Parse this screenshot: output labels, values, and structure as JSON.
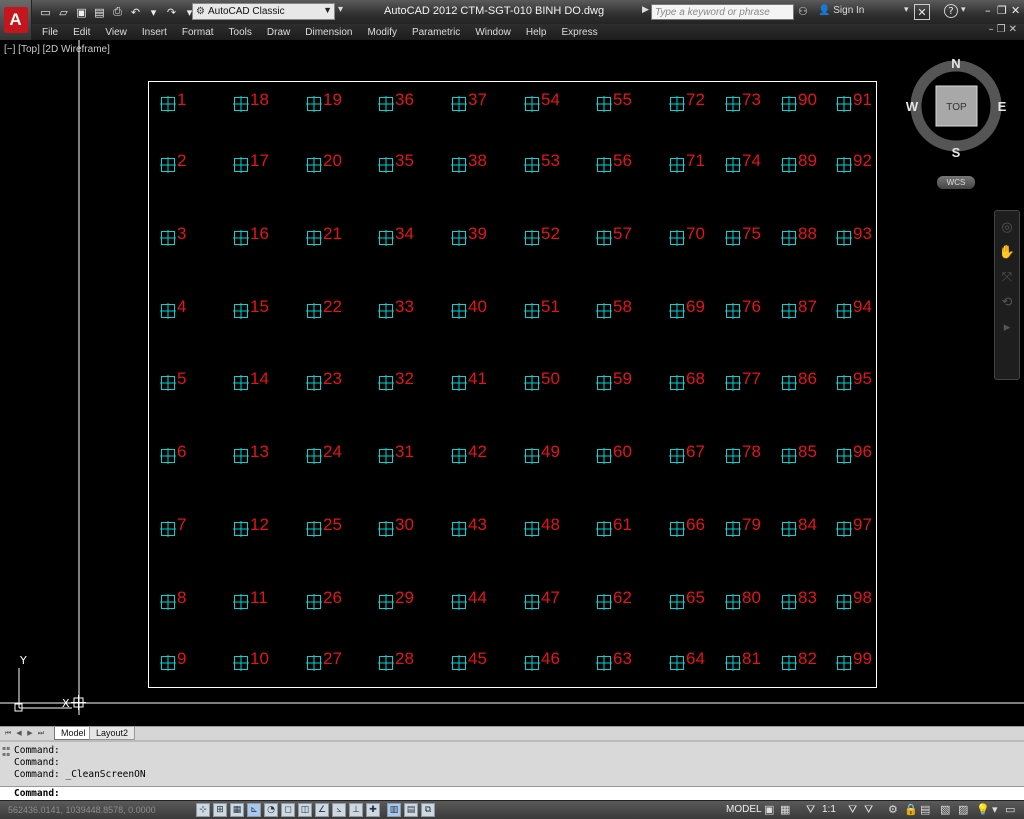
{
  "titlebar": {
    "app_logo": "A",
    "quick_access": [
      {
        "name": "new-icon",
        "glyph": "▭"
      },
      {
        "name": "open-icon",
        "glyph": "▱"
      },
      {
        "name": "save-icon",
        "glyph": "▣"
      },
      {
        "name": "saveas-icon",
        "glyph": "▤"
      },
      {
        "name": "print-icon",
        "glyph": "⎙"
      },
      {
        "name": "undo-icon",
        "glyph": "↶"
      },
      {
        "name": "undo-dropdown-icon",
        "glyph": "▾"
      },
      {
        "name": "redo-icon",
        "glyph": "↷"
      },
      {
        "name": "redo-dropdown-icon",
        "glyph": "▾"
      }
    ],
    "workspace": "AutoCAD Classic",
    "title": "AutoCAD 2012    CTM-SGT-010 BINH DO.dwg",
    "search_placeholder": "Type a keyword or phrase",
    "signin": "Sign In"
  },
  "menus": [
    "File",
    "Edit",
    "View",
    "Insert",
    "Format",
    "Tools",
    "Draw",
    "Dimension",
    "Modify",
    "Parametric",
    "Window",
    "Help",
    "Express"
  ],
  "viewport_label": "[−] [Top] [2D Wireframe]",
  "viewcube": {
    "north": "N",
    "south": "S",
    "east": "E",
    "west": "W",
    "face": "TOP",
    "wcs": "WCS"
  },
  "ucs": {
    "x": "X",
    "y": "Y"
  },
  "drawing": {
    "colors": {
      "frame": "#ffffff",
      "marker": "#00d6d6",
      "label": "#e4141c"
    },
    "columns": [
      [
        1,
        2,
        3,
        4,
        5,
        6,
        7,
        8,
        9
      ],
      [
        18,
        17,
        16,
        15,
        14,
        13,
        12,
        11,
        10
      ],
      [
        19,
        20,
        21,
        22,
        23,
        24,
        25,
        26,
        27
      ],
      [
        36,
        35,
        34,
        33,
        32,
        31,
        30,
        29,
        28
      ],
      [
        37,
        38,
        39,
        40,
        41,
        42,
        43,
        44,
        45
      ],
      [
        54,
        53,
        52,
        51,
        50,
        49,
        48,
        47,
        46
      ],
      [
        55,
        56,
        57,
        58,
        59,
        60,
        61,
        62,
        63
      ],
      [
        72,
        71,
        70,
        69,
        68,
        67,
        66,
        65,
        64
      ],
      [
        73,
        74,
        75,
        76,
        77,
        78,
        79,
        80,
        81
      ],
      [
        90,
        89,
        88,
        87,
        86,
        85,
        84,
        83,
        82
      ],
      [
        91,
        92,
        93,
        94,
        95,
        96,
        97,
        98,
        99
      ]
    ]
  },
  "tabs": {
    "model": "Model",
    "layout2": "Layout2"
  },
  "command": {
    "history": [
      "Command:",
      "Command:",
      "Command:  _CleanScreenON"
    ],
    "prompt": "Command:"
  },
  "status": {
    "coords": "562436.0141, 1039448.8578, 0.0000",
    "model": "MODEL",
    "scale": "1:1"
  }
}
